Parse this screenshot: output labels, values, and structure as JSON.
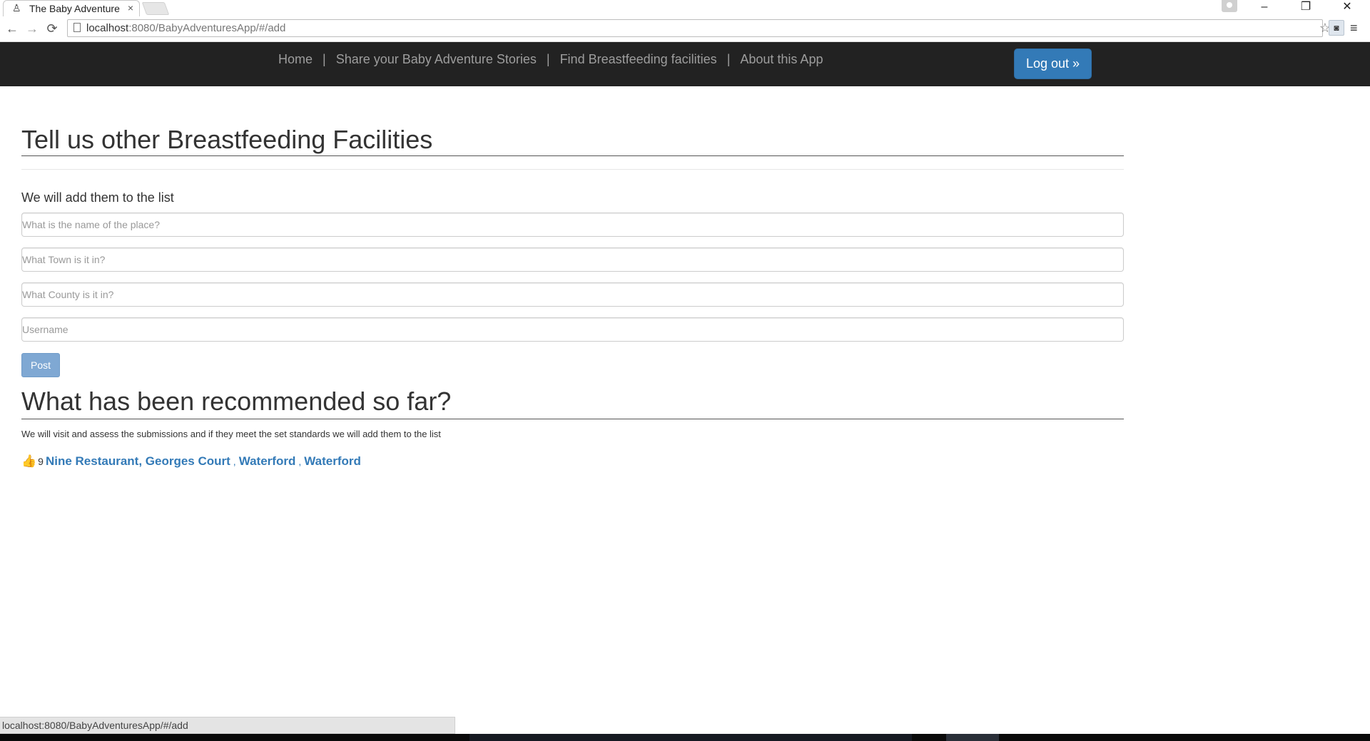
{
  "browser": {
    "tab_title": "The Baby Adventure",
    "tab_close": "×",
    "url_host": "localhost",
    "url_path": ":8080/BabyAdventuresApp/#/add",
    "status_url": "localhost:8080/BabyAdventuresApp/#/add",
    "icons": {
      "back": "←",
      "forward": "→",
      "reload": "⟳",
      "star": "☆",
      "menu": "≡",
      "minimize": "–",
      "restore": "❐",
      "close": "✕"
    }
  },
  "nav": {
    "links": [
      "Home",
      "Share your Baby Adventure Stories",
      "Find Breastfeeding facilities",
      "About this App"
    ],
    "separator": "|",
    "logout_label": "Log out »"
  },
  "form": {
    "title": "Tell us other Breastfeeding Facilities",
    "subtitle": "We will add them to the list",
    "place_placeholder": "What is the name of the place?",
    "town_placeholder": "What Town is it in?",
    "county_placeholder": "What County is it in?",
    "username_placeholder": "Username",
    "post_label": "Post"
  },
  "recommendations": {
    "title": "What has been recommended so far?",
    "note": "We will visit and assess the submissions and if they meet the set standards we will add them to the list",
    "items": [
      {
        "likes": "9",
        "place": "Nine Restaurant, Georges Court",
        "town": "Waterford",
        "county": "Waterford",
        "separator": ","
      }
    ]
  },
  "colors": {
    "navbar": "#222222",
    "primary": "#337ab7",
    "link": "#337ab7"
  }
}
